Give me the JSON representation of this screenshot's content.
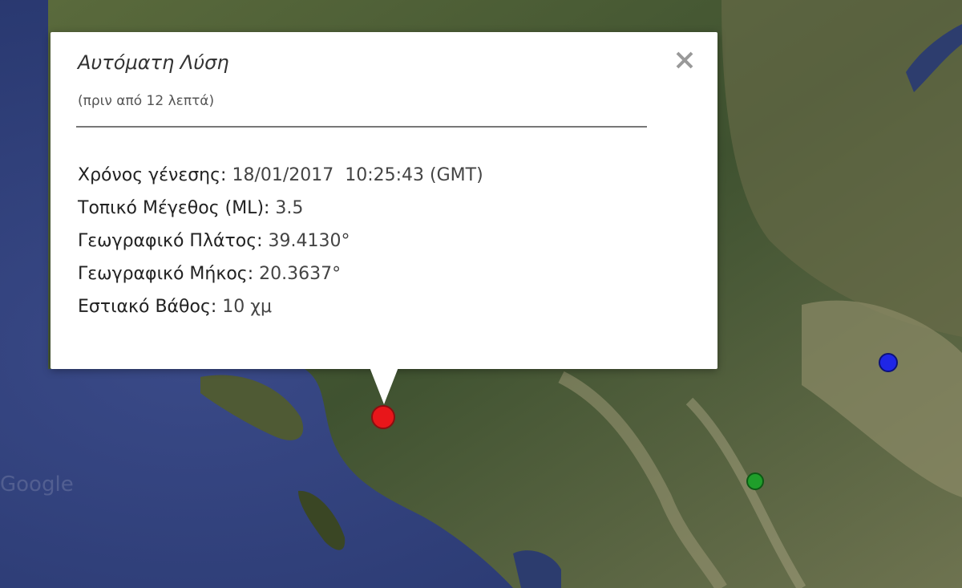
{
  "popup": {
    "title": "Αυτόματη Λύση",
    "subtitle": "(πριν από 12 λεπτά)",
    "close_icon": "close-icon",
    "fields": [
      {
        "label": "Χρόνος γένεσης:",
        "value": " 18/01/2017  10:25:43 (GMT)"
      },
      {
        "label": "Τοπικό Μέγεθος (ML):",
        "value": " 3.5"
      },
      {
        "label": "Γεωγραφικό Πλάτος:",
        "value": " 39.4130°"
      },
      {
        "label": "Γεωγραφικό Μήκος:",
        "value": " 20.3637°"
      },
      {
        "label": "Εστιακό Βάθος:",
        "value": " 10 χμ"
      }
    ]
  },
  "map": {
    "watermark": "Google",
    "colors": {
      "sea": "#2f3f7a",
      "land": "#4a5a34",
      "marker_red": "#e8161a",
      "marker_blue": "#1f26e6",
      "marker_green": "#1f9e2a"
    }
  }
}
